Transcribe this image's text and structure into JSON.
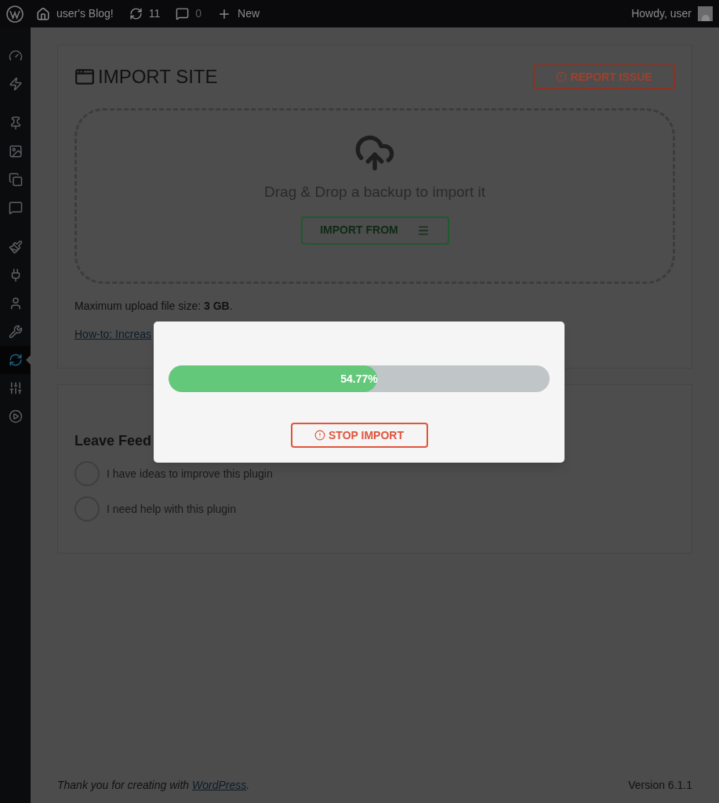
{
  "admin_bar": {
    "site": "user's Blog!",
    "updates": "11",
    "comments": "0",
    "new": "New",
    "greeting": "Howdy, user"
  },
  "sidebar": {
    "items": [
      {
        "selected": false
      },
      {
        "selected": false
      },
      {
        "selected": false
      },
      {
        "selected": false
      },
      {
        "selected": false
      },
      {
        "selected": false
      },
      {
        "selected": false
      },
      {
        "selected": false
      },
      {
        "selected": false
      },
      {
        "selected": false
      },
      {
        "selected": true
      },
      {
        "selected": false
      },
      {
        "selected": false
      }
    ]
  },
  "import_card": {
    "title": "IMPORT SITE",
    "report_button": "REPORT ISSUE",
    "drop_text": "Drag & Drop a backup to import it",
    "import_from_button": "IMPORT FROM",
    "max_upload": "Maximum upload file size: **3 GB**.",
    "howto_link": "How-to: Increas"
  },
  "feedback_card": {
    "title": "Leave Feed",
    "options": [
      {
        "label": "I have ideas to improve this plugin",
        "checked": false
      },
      {
        "label": "I need help with this plugin",
        "checked": false
      }
    ]
  },
  "modal": {
    "progress": {
      "level": 0.5477,
      "reading": "54.77%"
    },
    "stop_button": "STOP IMPORT"
  },
  "footer": {
    "thanks": "Thank you for creating with ",
    "link": "WordPress",
    "thanks_end": ".",
    "version": "Version 6.1.1"
  }
}
